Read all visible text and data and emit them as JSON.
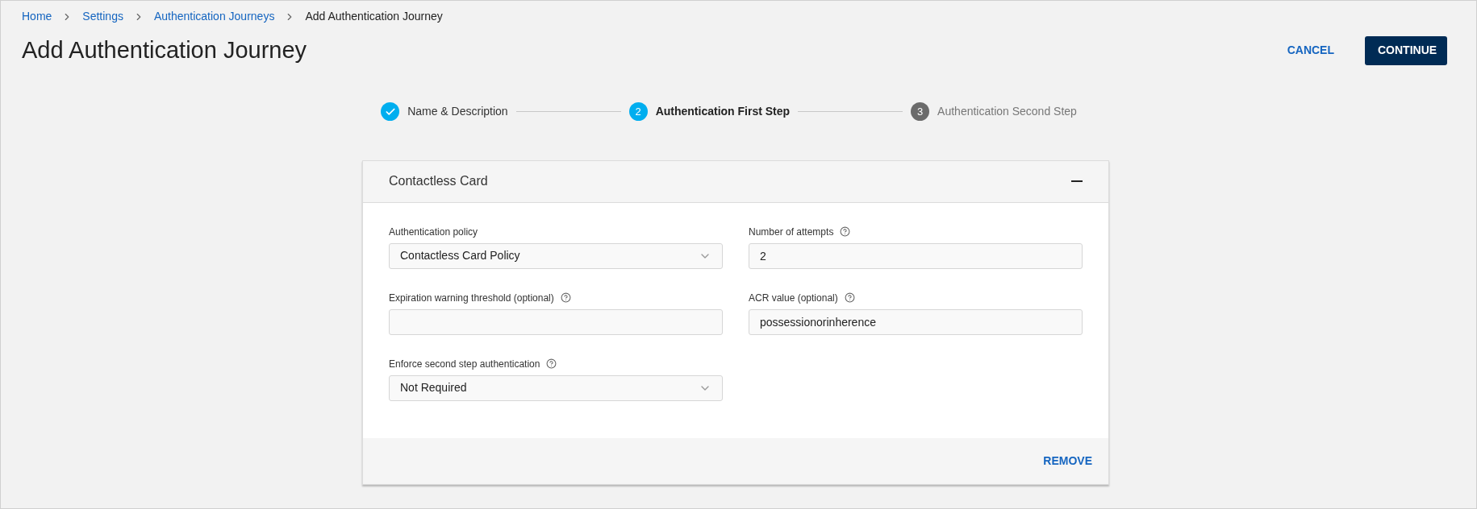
{
  "breadcrumbs": [
    {
      "label": "Home",
      "current": false
    },
    {
      "label": "Settings",
      "current": false
    },
    {
      "label": "Authentication Journeys",
      "current": false
    },
    {
      "label": "Add Authentication Journey",
      "current": true
    }
  ],
  "page_title": "Add Authentication Journey",
  "actions": {
    "cancel": "CANCEL",
    "continue": "CONTINUE"
  },
  "steps": [
    {
      "label": "Name & Description",
      "completed": true,
      "selected": false
    },
    {
      "number": "2",
      "label": "Authentication First Step",
      "completed": false,
      "selected": true
    },
    {
      "number": "3",
      "label": "Authentication Second Step",
      "completed": false,
      "selected": false
    }
  ],
  "card": {
    "title": "Contactless Card",
    "expanded": true,
    "fields": [
      {
        "label": "Authentication policy",
        "kind": "select",
        "help": false,
        "value": "Contactless Card Policy"
      },
      {
        "label": "Number of attempts",
        "kind": "text",
        "help": true,
        "value": "2"
      },
      {
        "label": "Expiration warning threshold (optional)",
        "kind": "text",
        "help": true
      },
      {
        "label": "ACR value (optional)",
        "kind": "text",
        "help": true,
        "value": "possessionorinherence"
      },
      {
        "label": "Enforce second step authentication",
        "kind": "select",
        "help": true,
        "value": "Not Required"
      }
    ],
    "remove": "REMOVE"
  }
}
